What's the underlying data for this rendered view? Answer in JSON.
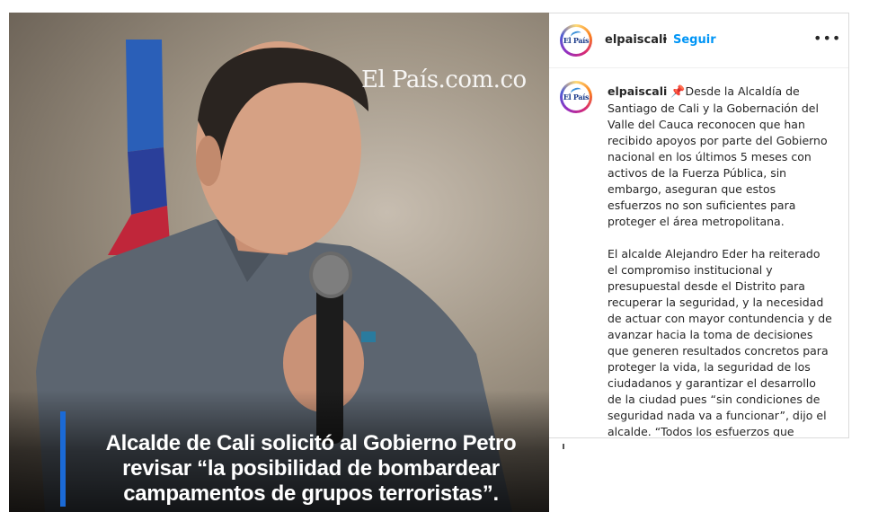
{
  "post_image": {
    "watermark": "El País.com.co",
    "headline_lines": [
      "Alcalde de Cali solicitó al Gobierno Petro",
      "revisar “la posibilidad de bombardear",
      "campamentos de grupos terroristas”."
    ]
  },
  "header": {
    "avatar_logo": "El País",
    "username": "elpaiscali",
    "separator": "•",
    "follow_label": "Seguir",
    "more_label": "•••"
  },
  "caption": {
    "avatar_logo": "El País",
    "username": "elpaiscali",
    "pin_icon": "pushpin-icon",
    "paragraph1": "Desde la Alcaldía de Santiago de Cali y la Gobernación del Valle del Cauca reconocen que han recibido apoyos por parte del Gobierno nacional en los últimos 5 meses con activos de la Fuerza Pública, sin embargo, aseguran que estos esfuerzos no son suficientes para proteger el área metropolitana.",
    "paragraph2": "El alcalde Alejandro Eder ha reiterado el compromiso institucional y presupuestal desde el Distrito para recuperar la seguridad, y la necesidad de actuar con mayor contundencia y de avanzar hacia la toma de decisiones que generen resultados concretos para proteger la vida, la seguridad de los ciudadanos y garantizar el desarrollo de la ciudad pues “sin condiciones de seguridad nada va a funcionar”, dijo el alcalde. “Todos los esfuerzos que"
  },
  "colors": {
    "follow": "#0095f6",
    "caption_bar": "#1b6ad6",
    "text": "#262626"
  }
}
